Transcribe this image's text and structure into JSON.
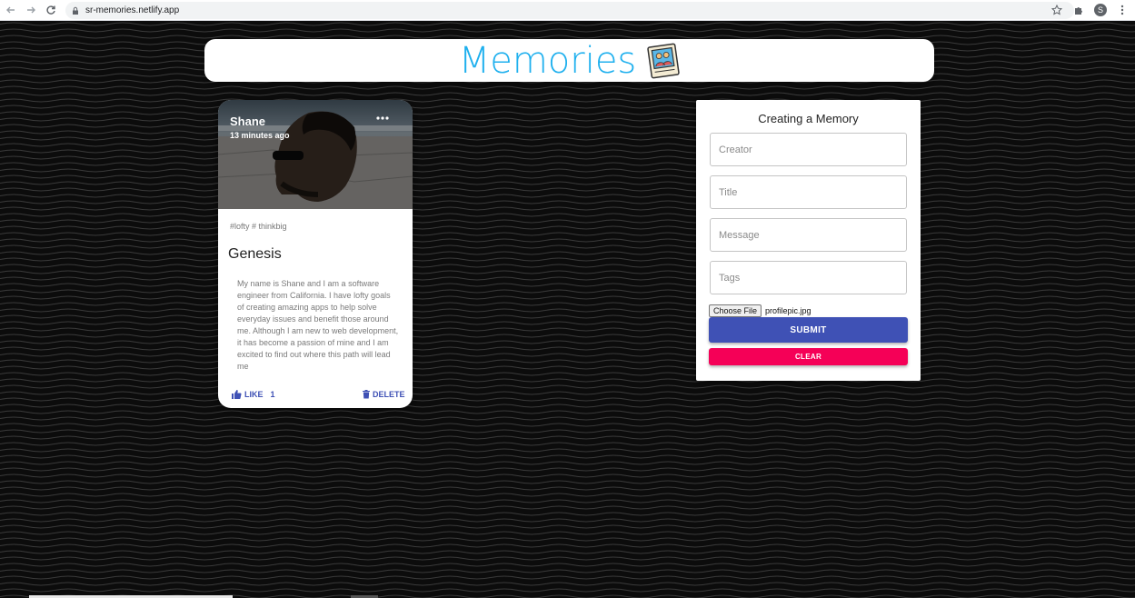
{
  "browser": {
    "url": "sr-memories.netlify.app",
    "profile_initial": "S"
  },
  "app": {
    "title": "Memories",
    "title_color": "#1fb0ee"
  },
  "post": {
    "creator": "Shane",
    "time": "13 minutes ago",
    "tags": "#lofty # thinkbig",
    "title": "Genesis",
    "message": "My name is Shane and I am a software engineer from California. I have lofty goals of creating amazing apps to help solve everyday issues and benefit those around me. Although I am new to web development, it has become a passion of mine and I am excited to find out where this path will lead me",
    "like_label": "LIKE",
    "like_count": "1",
    "delete_label": "DELETE",
    "accent": "#3f51b5"
  },
  "form": {
    "title": "Creating a Memory",
    "fields": {
      "creator_placeholder": "Creator",
      "title_placeholder": "Title",
      "message_placeholder": "Message",
      "tags_placeholder": "Tags"
    },
    "file_button": "Choose File",
    "file_name": "profilepic.jpg",
    "submit_label": "SUBMIT",
    "clear_label": "CLEAR",
    "submit_color": "#3f51b5",
    "clear_color": "#f50057"
  },
  "icons": {
    "back": "arrow-left-icon",
    "forward": "arrow-right-icon",
    "reload": "reload-icon",
    "lock": "lock-icon",
    "star": "star-icon",
    "extensions": "puzzle-icon",
    "menu": "kebab-menu-icon",
    "logo": "photo-album-icon",
    "more": "more-horiz-icon",
    "like": "thumb-up-icon",
    "delete": "trash-icon"
  }
}
